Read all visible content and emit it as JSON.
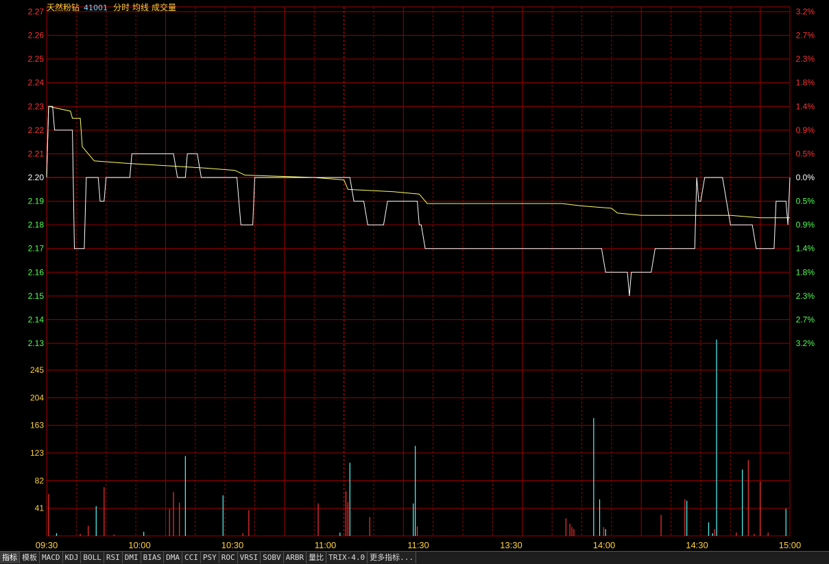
{
  "header": {
    "name": "天然粉钻",
    "code": "41001",
    "mode_label": "分时",
    "avg_label": "均线",
    "vol_label": "成交量"
  },
  "colors": {
    "up": "#ff3232",
    "down": "#54ff54",
    "neutral": "#ffffff",
    "avg_line": "#ffff66",
    "price_line": "#ffffff",
    "grid": "#a00000",
    "vol_up": "#ff3232",
    "vol_down": "#54ffff",
    "volume_axis": "#ffd23c"
  },
  "price_axis": {
    "labels": [
      "2.27",
      "2.26",
      "2.25",
      "2.24",
      "2.23",
      "2.22",
      "2.21",
      "2.20",
      "2.19",
      "2.18",
      "2.17",
      "2.16",
      "2.15",
      "2.14",
      "2.13"
    ],
    "pct_labels": [
      "3.2%",
      "2.7%",
      "2.3%",
      "1.8%",
      "1.4%",
      "0.9%",
      "0.5%",
      "0.0%",
      "0.5%",
      "0.9%",
      "1.4%",
      "1.8%",
      "2.3%",
      "2.7%",
      "3.2%"
    ]
  },
  "volume_axis": {
    "labels": [
      "245",
      "204",
      "163",
      "123",
      "82",
      "41"
    ]
  },
  "time_axis": {
    "labels": [
      "09:30",
      "10:00",
      "10:30",
      "11:00",
      "11:30",
      "13:30",
      "14:00",
      "14:30",
      "15:00"
    ]
  },
  "chart_data": {
    "type": "line",
    "prev_close": 2.2,
    "ylim": [
      2.13,
      2.27
    ],
    "price_series": [
      [
        0,
        2.2
      ],
      [
        1,
        2.23
      ],
      [
        3,
        2.23
      ],
      [
        4,
        2.22
      ],
      [
        13,
        2.22
      ],
      [
        14,
        2.17
      ],
      [
        19,
        2.17
      ],
      [
        20,
        2.2
      ],
      [
        26,
        2.2
      ],
      [
        27,
        2.19
      ],
      [
        29,
        2.19
      ],
      [
        30,
        2.2
      ],
      [
        42,
        2.2
      ],
      [
        43,
        2.21
      ],
      [
        64,
        2.21
      ],
      [
        66,
        2.2
      ],
      [
        70,
        2.2
      ],
      [
        71,
        2.21
      ],
      [
        76,
        2.21
      ],
      [
        78,
        2.2
      ],
      [
        96,
        2.2
      ],
      [
        98,
        2.18
      ],
      [
        104,
        2.18
      ],
      [
        105,
        2.2
      ],
      [
        153,
        2.2
      ],
      [
        155,
        2.19
      ],
      [
        160,
        2.19
      ],
      [
        162,
        2.18
      ],
      [
        170,
        2.18
      ],
      [
        172,
        2.19
      ],
      [
        187,
        2.19
      ],
      [
        188,
        2.18
      ],
      [
        189,
        2.18
      ],
      [
        191,
        2.17
      ],
      [
        280,
        2.17
      ],
      [
        282,
        2.16
      ],
      [
        293,
        2.16
      ],
      [
        294,
        2.15
      ],
      [
        295,
        2.16
      ],
      [
        305,
        2.16
      ],
      [
        307,
        2.17
      ],
      [
        327,
        2.17
      ],
      [
        328,
        2.2
      ],
      [
        329,
        2.19
      ],
      [
        330,
        2.19
      ],
      [
        332,
        2.2
      ],
      [
        341,
        2.2
      ],
      [
        343,
        2.19
      ],
      [
        345,
        2.18
      ],
      [
        356,
        2.18
      ],
      [
        358,
        2.17
      ],
      [
        367,
        2.17
      ],
      [
        368,
        2.19
      ],
      [
        373,
        2.19
      ],
      [
        374,
        2.18
      ],
      [
        375,
        2.2
      ]
    ],
    "avg_series": [
      [
        0,
        2.2
      ],
      [
        1,
        2.23
      ],
      [
        12,
        2.228
      ],
      [
        13,
        2.225
      ],
      [
        17,
        2.225
      ],
      [
        18,
        2.213
      ],
      [
        21,
        2.21
      ],
      [
        24,
        2.207
      ],
      [
        40,
        2.206
      ],
      [
        60,
        2.205
      ],
      [
        80,
        2.204
      ],
      [
        95,
        2.203
      ],
      [
        100,
        2.201
      ],
      [
        135,
        2.2
      ],
      [
        150,
        2.199
      ],
      [
        152,
        2.195
      ],
      [
        175,
        2.194
      ],
      [
        188,
        2.193
      ],
      [
        192,
        2.189
      ],
      [
        260,
        2.189
      ],
      [
        270,
        2.188
      ],
      [
        285,
        2.187
      ],
      [
        288,
        2.185
      ],
      [
        300,
        2.184
      ],
      [
        330,
        2.184
      ],
      [
        345,
        2.184
      ],
      [
        360,
        2.183
      ],
      [
        375,
        2.183
      ]
    ],
    "volume": [
      [
        1,
        62,
        "up"
      ],
      [
        5,
        4,
        "down"
      ],
      [
        17,
        3,
        "up"
      ],
      [
        21,
        15,
        "up"
      ],
      [
        25,
        44,
        "down"
      ],
      [
        29,
        72,
        "up"
      ],
      [
        34,
        2,
        "up"
      ],
      [
        49,
        6,
        "down"
      ],
      [
        62,
        40,
        "up"
      ],
      [
        64,
        65,
        "up"
      ],
      [
        67,
        49,
        "up"
      ],
      [
        70,
        118,
        "down"
      ],
      [
        89,
        60,
        "down"
      ],
      [
        99,
        4,
        "up"
      ],
      [
        102,
        38,
        "up"
      ],
      [
        137,
        48,
        "up"
      ],
      [
        148,
        5,
        "down"
      ],
      [
        151,
        66,
        "up"
      ],
      [
        152,
        50,
        "up"
      ],
      [
        153,
        108,
        "down"
      ],
      [
        163,
        28,
        "up"
      ],
      [
        185,
        48,
        "down"
      ],
      [
        186,
        133,
        "down"
      ],
      [
        187,
        14,
        "up"
      ],
      [
        262,
        26,
        "up"
      ],
      [
        264,
        18,
        "up"
      ],
      [
        265,
        13,
        "up"
      ],
      [
        266,
        10,
        "up"
      ],
      [
        276,
        174,
        "down"
      ],
      [
        279,
        54,
        "down"
      ],
      [
        281,
        13,
        "up"
      ],
      [
        282,
        10,
        "down"
      ],
      [
        310,
        31,
        "up"
      ],
      [
        322,
        54,
        "up"
      ],
      [
        323,
        52,
        "down"
      ],
      [
        334,
        20,
        "down"
      ],
      [
        336,
        4,
        "down"
      ],
      [
        337,
        10,
        "up"
      ],
      [
        338,
        290,
        "down"
      ],
      [
        348,
        5,
        "up"
      ],
      [
        351,
        98,
        "down"
      ],
      [
        354,
        112,
        "up"
      ],
      [
        357,
        3,
        "up"
      ],
      [
        360,
        80,
        "up"
      ],
      [
        364,
        5,
        "up"
      ],
      [
        373,
        40,
        "down"
      ]
    ]
  },
  "toolbar": {
    "tabs": [
      "指标",
      "模板",
      "MACD",
      "KDJ",
      "BOLL",
      "RSI",
      "DMI",
      "BIAS",
      "DMA",
      "CCI",
      "PSY",
      "ROC",
      "VRSI",
      "SOBV",
      "ARBR",
      "量比",
      "TRIX-4.0",
      "更多指标..."
    ]
  }
}
